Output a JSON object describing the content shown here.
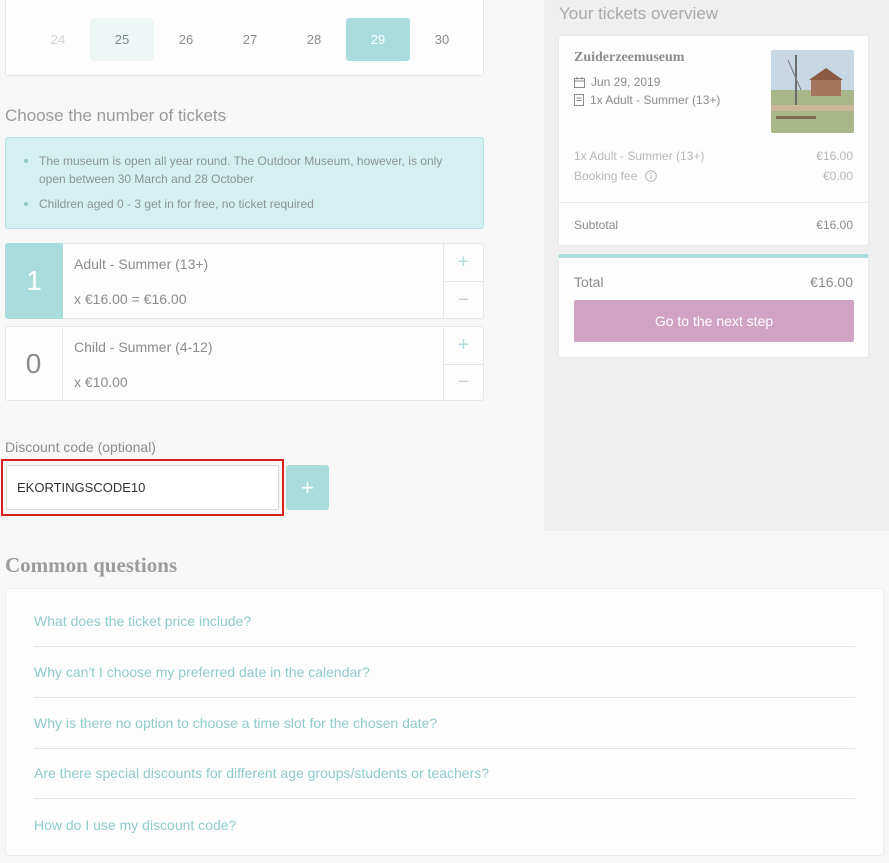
{
  "calendar": {
    "days": [
      {
        "label": "24",
        "state": "disabled"
      },
      {
        "label": "25",
        "state": "soft"
      },
      {
        "label": "26",
        "state": "normal"
      },
      {
        "label": "27",
        "state": "normal"
      },
      {
        "label": "28",
        "state": "normal"
      },
      {
        "label": "29",
        "state": "selected"
      },
      {
        "label": "30",
        "state": "normal"
      }
    ]
  },
  "tickets_section": {
    "title": "Choose the number of tickets",
    "info": [
      "The museum is open all year round. The Outdoor Museum, however, is only open between 30 March and 28 October",
      "Children aged 0 - 3 get in for free, no ticket required"
    ],
    "rows": [
      {
        "qty": "1",
        "name": "Adult - Summer (13+)",
        "price": "x €16.00 = €16.00",
        "plus": "+",
        "minus": "−"
      },
      {
        "qty": "0",
        "name": "Child - Summer (4-12)",
        "price": "x €10.00",
        "plus": "+",
        "minus": "−"
      }
    ]
  },
  "discount": {
    "label": "Discount code (optional)",
    "value": "EKORTINGSCODE10",
    "add_label": "+"
  },
  "overview": {
    "title": "Your tickets overview",
    "museum": "Zuiderzeemuseum",
    "date": "Jun 29, 2019",
    "ticket_summary": "1x Adult - Summer (13+)",
    "line_items": [
      {
        "label": "1x Adult - Summer (13+)",
        "amount": "€16.00"
      },
      {
        "label": "Booking fee",
        "amount": "€0.00"
      }
    ],
    "subtotal_label": "Subtotal",
    "subtotal_amount": "€16.00",
    "total_label": "Total",
    "total_amount": "€16.00",
    "next_button": "Go to the next step"
  },
  "faq": {
    "title": "Common questions",
    "items": [
      "What does the ticket price include?",
      "Why can't I choose my preferred date in the calendar?",
      "Why is there no option to choose a time slot for the chosen date?",
      "Are there special discounts for different age groups/students or teachers?",
      "How do I use my discount code?"
    ]
  },
  "colors": {
    "accent": "#a9dcdc",
    "cta": "#cfa3c1",
    "highlight": "#d8201e",
    "faq_link": "#8fcbcb"
  }
}
